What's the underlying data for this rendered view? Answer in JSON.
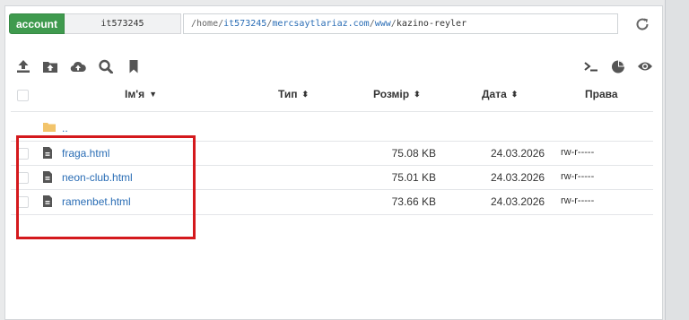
{
  "topbar": {
    "account_label": "account",
    "login": "it573245",
    "path_segments": [
      "/home/",
      "it573245",
      "/",
      "mercsaytlariaz.com",
      "/",
      "www",
      "/"
    ],
    "path_last": "kazino-reyler"
  },
  "toolbar": {
    "icons": [
      "upload-icon",
      "folder-upload-icon",
      "cloud-upload-icon",
      "search-icon",
      "bookmark-icon",
      "terminal-icon",
      "pie-chart-icon",
      "eye-icon"
    ]
  },
  "table": {
    "headers": {
      "name": "Ім'я",
      "type": "Тип",
      "size": "Розмір",
      "date": "Дата",
      "perms": "Права"
    },
    "parent_label": "..",
    "rows": [
      {
        "name": "fraga.html",
        "size": "75.08 KB",
        "date": "24.03.2026",
        "perms": "rw-r-----"
      },
      {
        "name": "neon-club.html",
        "size": "75.01 KB",
        "date": "24.03.2026",
        "perms": "rw-r-----"
      },
      {
        "name": "ramenbet.html",
        "size": "73.66 KB",
        "date": "24.03.2026",
        "perms": "rw-r-----"
      }
    ]
  },
  "colors": {
    "account_green": "#3f9a4e",
    "link_blue": "#2a6db5",
    "highlight_red": "#d4191d"
  }
}
